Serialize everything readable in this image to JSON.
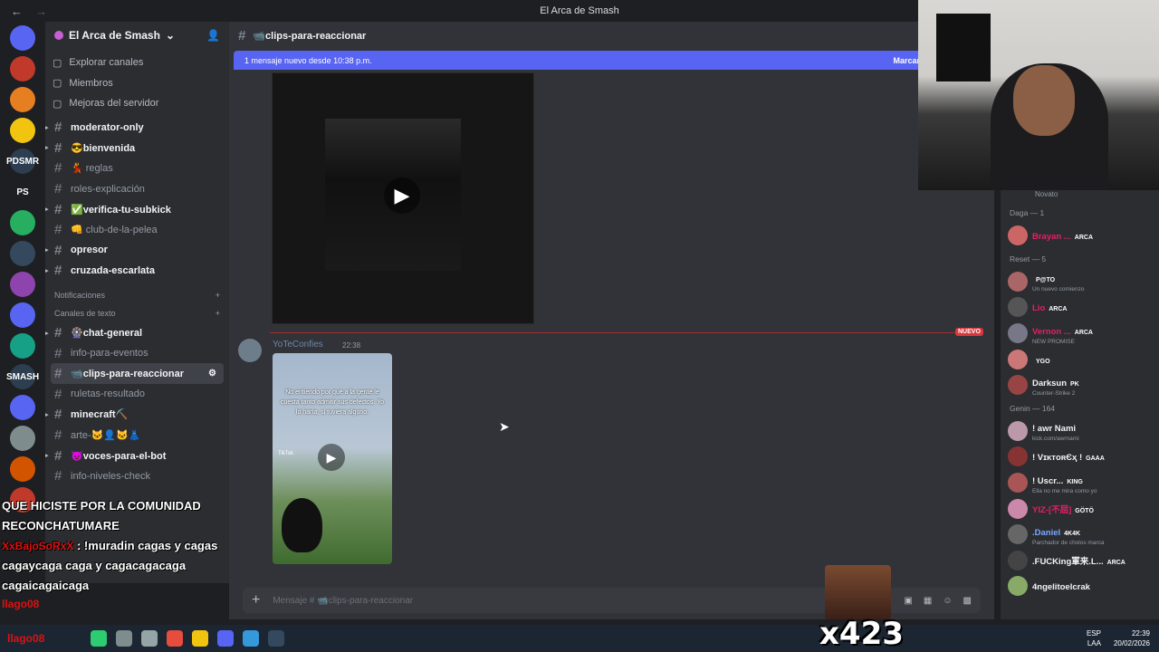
{
  "window": {
    "title": "El Arca de Smash",
    "back": "←",
    "fwd": "→"
  },
  "server": {
    "name": "El Arca de Smash"
  },
  "guilds": [
    {
      "label": "",
      "color": "#5865f2",
      "badge": "1"
    },
    {
      "label": "",
      "color": "#c0392b"
    },
    {
      "label": "",
      "color": "#e67e22"
    },
    {
      "label": "",
      "color": "#f1c40f"
    },
    {
      "label": "PDSMR",
      "color": "#2c3e50"
    },
    {
      "label": "PS",
      "color": "#1e1f22"
    },
    {
      "label": "",
      "color": "#27ae60"
    },
    {
      "label": "",
      "color": "#34495e"
    },
    {
      "label": "",
      "color": "#8e44ad"
    },
    {
      "label": "",
      "color": "#5865f2"
    },
    {
      "label": "",
      "color": "#16a085"
    },
    {
      "label": "SMASH",
      "color": "#2c3e50"
    },
    {
      "label": "",
      "color": "#5865f2"
    },
    {
      "label": "",
      "color": "#7f8c8d"
    },
    {
      "label": "",
      "color": "#d35400"
    },
    {
      "label": "",
      "color": "#c0392b"
    }
  ],
  "nav_top": [
    "Explorar canales",
    "Miembros",
    "Mejoras del servidor"
  ],
  "channels_a": [
    {
      "name": "moderator-only",
      "bold": true,
      "arrow": true
    },
    {
      "name": "😎bienvenida",
      "bold": true,
      "arrow": true
    },
    {
      "name": "💃 reglas",
      "bold": false
    },
    {
      "name": "roles-explicación",
      "bold": false
    },
    {
      "name": "✅verifica-tu-subkick",
      "bold": true,
      "arrow": true
    },
    {
      "name": "👊 club-de-la-pelea",
      "bold": false
    },
    {
      "name": "opresor",
      "bold": true,
      "arrow": true
    },
    {
      "name": "cruzada-escarlata",
      "bold": true,
      "arrow": true
    }
  ],
  "cat_notif": "Notificaciones",
  "cat_text": "Canales de texto",
  "channels_b": [
    {
      "name": "🎡chat-general",
      "bold": true,
      "arrow": true
    },
    {
      "name": "info-para-eventos",
      "bold": false
    },
    {
      "name": "📹clips-para-reaccionar",
      "bold": true,
      "active": true
    },
    {
      "name": "ruletas-resultado",
      "bold": false
    },
    {
      "name": "minecraft⛏️",
      "bold": true,
      "arrow": true
    },
    {
      "name": "arte-🐱👤🐱👗",
      "bold": false
    },
    {
      "name": "😈voces-para-el-bot",
      "bold": true,
      "arrow": true
    },
    {
      "name": "info-niveles-check",
      "bold": false
    }
  ],
  "main": {
    "channel": "📹clips-para-reaccionar",
    "banner_left": "1 mensaje nuevo desde 10:38 p.m.",
    "banner_right": "Marcar",
    "nuevo": "NUEVO",
    "msg_user": "YoTeConfies",
    "msg_time": "22:38",
    "video_caption": "No entiendo por qué a la gente le cuesta tanto admitir sus defectos. Yo lo haría, si tuviera alguno.",
    "tiktok": "TikTok",
    "composer_placeholder": "Mensaje # 📹clips-para-reaccionar"
  },
  "members": {
    "partial_top": "Novato",
    "groups": [
      {
        "title": "Daga — 1",
        "items": [
          {
            "name": "Brayan ...",
            "tag": "ARCA",
            "sub": "",
            "color": "#e91e63",
            "av": "#c66"
          }
        ]
      },
      {
        "title": "Reset — 5",
        "items": [
          {
            "name": "",
            "tag": "P@TO",
            "sub": "Un nuevo comienzo",
            "color": "#e91e63",
            "av": "#a66"
          },
          {
            "name": "Lio",
            "tag": "ARCA",
            "sub": "",
            "color": "#e91e63",
            "av": "#555"
          },
          {
            "name": "Vernon ...",
            "tag": "ARCA",
            "sub": "NEW PROMISE",
            "color": "#e91e63",
            "av": "#778"
          },
          {
            "name": "",
            "tag": "YGO",
            "sub": "",
            "color": "#e91e63",
            "av": "#c77"
          },
          {
            "name": "Darksun",
            "tag": "PK",
            "sub": "Counter-Strike 2",
            "color": "#f2f3f5",
            "av": "#944"
          }
        ]
      },
      {
        "title": "Genin — 164",
        "items": [
          {
            "name": "! awr Nami",
            "tag": "",
            "sub": "kick.com/awrnami",
            "color": "#f2f3f5",
            "av": "#b9a"
          },
          {
            "name": "! VɪᴋᴛᴏʀЄҳ !",
            "tag": "GAAA",
            "sub": "",
            "color": "#f2f3f5",
            "av": "#833"
          },
          {
            "name": "! Uscr...",
            "tag": "KING",
            "sub": "Ella no me mira como yo",
            "color": "#f2f3f5",
            "av": "#a55"
          },
          {
            "name": "YIZ-[不屈]",
            "tag": "GÖTÖ",
            "sub": "",
            "color": "#e91e63",
            "av": "#c8a"
          },
          {
            "name": ".Daniel",
            "tag": "4K4K",
            "sub": "Parchador de cholos marca",
            "color": "#7ba7ff",
            "av": "#666"
          },
          {
            "name": ".FUCKing軍来.L...",
            "tag": "ARCA",
            "sub": "",
            "color": "#f2f3f5",
            "av": "#444"
          },
          {
            "name": "4ngelitoelcrak",
            "tag": "",
            "sub": "",
            "color": "#f2f3f5",
            "av": "#8a6"
          }
        ]
      }
    ]
  },
  "overlay": {
    "line1": "QUE HICISTE POR LA COMUNIDAD RECONCHATUMARE",
    "user2": "XxBajoSoRxX",
    "line2": ": !muradin cagas y cagas cagaycaga caga y cagacagacaga cagaicagaicaga",
    "user3": "llago08",
    "user4": "llago08",
    "combo": "x423"
  },
  "taskbar": {
    "lang": "ESP",
    "lang2": "LAA",
    "time": "22:39",
    "date": "20/02/2026"
  }
}
